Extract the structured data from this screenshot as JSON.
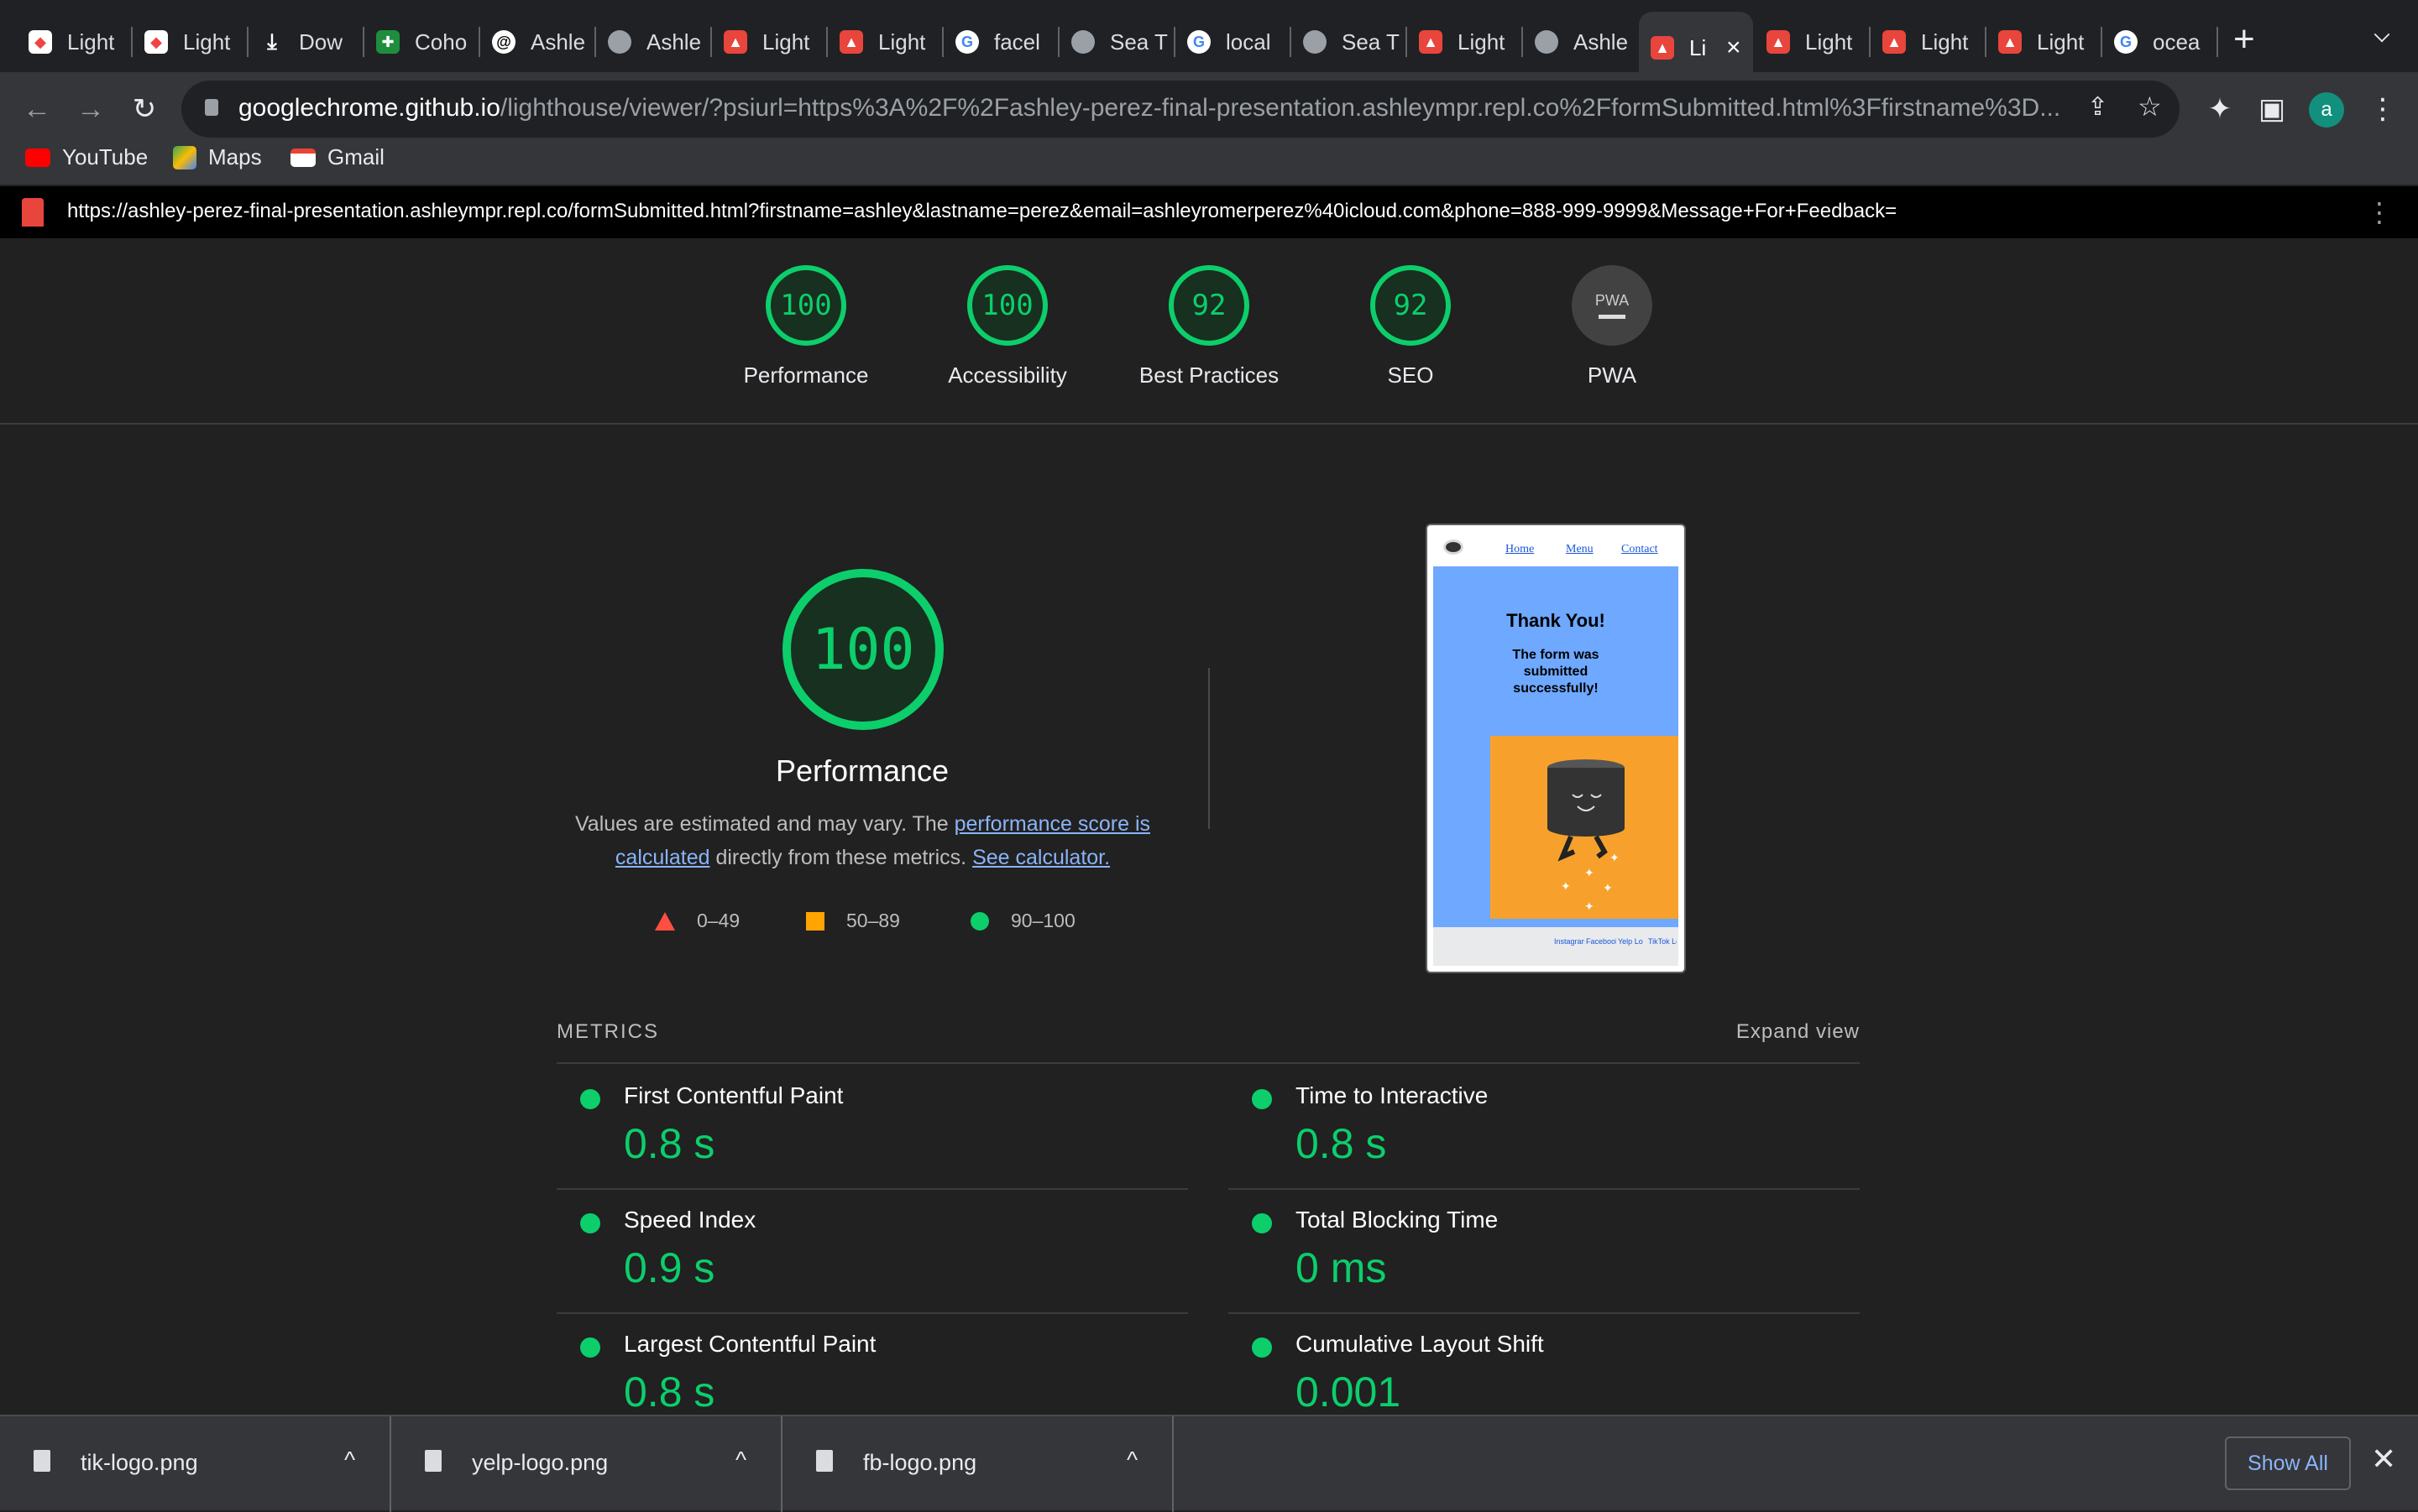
{
  "browser": {
    "tabs": [
      {
        "title": "Light"
      },
      {
        "title": "Light"
      },
      {
        "title": "Dow"
      },
      {
        "title": "Coho"
      },
      {
        "title": "Ashle"
      },
      {
        "title": "Ashle"
      },
      {
        "title": "Light"
      },
      {
        "title": "Light"
      },
      {
        "title": "facel"
      },
      {
        "title": "Sea T"
      },
      {
        "title": "local"
      },
      {
        "title": "Sea T"
      },
      {
        "title": "Light"
      },
      {
        "title": "Ashle"
      },
      {
        "title": "Li"
      },
      {
        "title": "Light"
      },
      {
        "title": "Light"
      },
      {
        "title": "Light"
      },
      {
        "title": "ocea"
      }
    ],
    "active_tab_index": 14,
    "new_tab_symbol": "+",
    "url_host": "googlechrome.github.io",
    "url_path": "/lighthouse/viewer/?psiurl=https%3A%2F%2Fashley-perez-final-presentation.ashleympr.repl.co%2FformSubmitted.html%3Ffirstname%3D...",
    "profile_initial": "a",
    "bookmarks": [
      {
        "label": "YouTube"
      },
      {
        "label": "Maps"
      },
      {
        "label": "Gmail"
      }
    ]
  },
  "viewer": {
    "url": "https://ashley-perez-final-presentation.ashleympr.repl.co/formSubmitted.html?firstname=ashley&lastname=perez&email=ashleyromerperez%40icloud.com&phone=888-999-9999&Message+For+Feedback="
  },
  "scores": [
    {
      "label": "Performance",
      "value": "100"
    },
    {
      "label": "Accessibility",
      "value": "100"
    },
    {
      "label": "Best Practices",
      "value": "92"
    },
    {
      "label": "SEO",
      "value": "92"
    },
    {
      "label": "PWA",
      "value": "PWA"
    }
  ],
  "performance": {
    "score": "100",
    "title": "Performance",
    "desc_prefix": "Values are estimated and may vary. The ",
    "desc_link1": "performance score is calculated",
    "desc_middle": " directly from these metrics. ",
    "desc_link2": "See calculator.",
    "legend": [
      {
        "label": "0–49",
        "color": "#ff4e42"
      },
      {
        "label": "50–89",
        "color": "#ffa400"
      },
      {
        "label": "90–100",
        "color": "#0cce6b"
      }
    ]
  },
  "screenshot": {
    "nav": [
      "Home",
      "Menu",
      "Contact"
    ],
    "heading": "Thank You!",
    "message": "The form was submitted successfully!",
    "footer_logos": [
      "Instagram Logo",
      "Facebook Logo",
      "Yelp Logo",
      "TikTok Logo"
    ]
  },
  "metrics": {
    "title": "METRICS",
    "expand_label": "Expand view",
    "items": [
      {
        "title": "First Contentful Paint",
        "value": "0.8 s"
      },
      {
        "title": "Time to Interactive",
        "value": "0.8 s"
      },
      {
        "title": "Speed Index",
        "value": "0.9 s"
      },
      {
        "title": "Total Blocking Time",
        "value": "0 ms"
      },
      {
        "title": "Largest Contentful Paint",
        "value": "0.8 s"
      },
      {
        "title": "Cumulative Layout Shift",
        "value": "0.001"
      }
    ]
  },
  "downloads": {
    "items": [
      {
        "filename": "tik-logo.png"
      },
      {
        "filename": "yelp-logo.png"
      },
      {
        "filename": "fb-logo.png"
      }
    ],
    "show_all": "Show All"
  },
  "colors": {
    "pass": "#0cce6b",
    "average": "#ffa400",
    "fail": "#ff4e42",
    "background": "#212121"
  }
}
